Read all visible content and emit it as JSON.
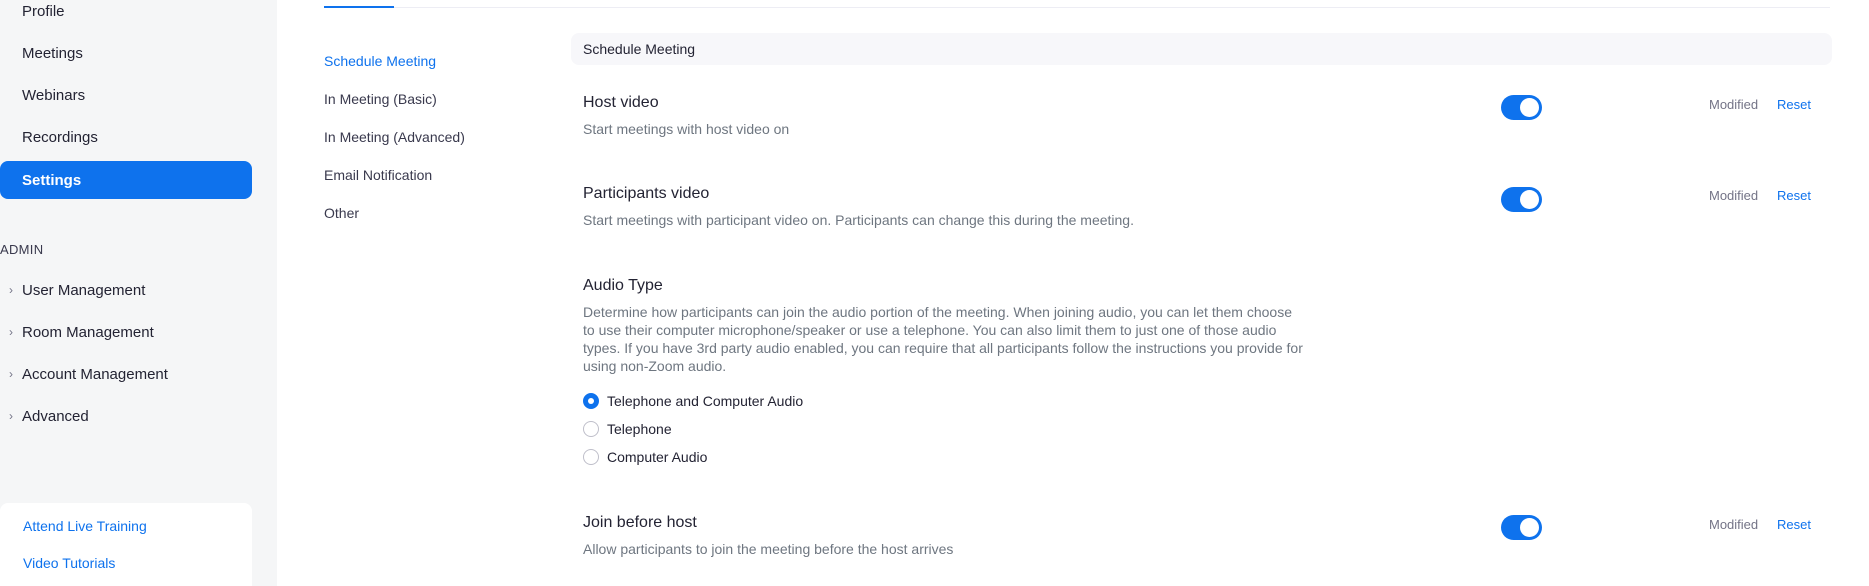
{
  "sidebar": {
    "nav": [
      {
        "label": "Profile"
      },
      {
        "label": "Meetings"
      },
      {
        "label": "Webinars"
      },
      {
        "label": "Recordings"
      },
      {
        "label": "Settings",
        "active": true
      }
    ],
    "admin_label": "ADMIN",
    "admin_items": [
      {
        "label": "User Management"
      },
      {
        "label": "Room Management"
      },
      {
        "label": "Account Management"
      },
      {
        "label": "Advanced"
      }
    ],
    "links": [
      {
        "label": "Attend Live Training"
      },
      {
        "label": "Video Tutorials"
      }
    ]
  },
  "subnav": [
    {
      "label": "Schedule Meeting",
      "active": true
    },
    {
      "label": "In Meeting (Basic)"
    },
    {
      "label": "In Meeting (Advanced)"
    },
    {
      "label": "Email Notification"
    },
    {
      "label": "Other"
    }
  ],
  "section": {
    "title": "Schedule Meeting"
  },
  "settings": {
    "host_video": {
      "title": "Host video",
      "description": "Start meetings with host video on",
      "enabled": true,
      "modified_label": "Modified",
      "reset_label": "Reset"
    },
    "participants_video": {
      "title": "Participants video",
      "description": "Start meetings with participant video on. Participants can change this during the meeting.",
      "enabled": true,
      "modified_label": "Modified",
      "reset_label": "Reset"
    },
    "audio_type": {
      "title": "Audio Type",
      "description": "Determine how participants can join the audio portion of the meeting. When joining audio, you can let them choose to use their computer microphone/speaker or use a telephone. You can also limit them to just one of those audio types. If you have 3rd party audio enabled, you can require that all participants follow the instructions you provide for using non-Zoom audio.",
      "options": [
        {
          "label": "Telephone and Computer Audio",
          "selected": true
        },
        {
          "label": "Telephone",
          "selected": false
        },
        {
          "label": "Computer Audio",
          "selected": false
        }
      ]
    },
    "join_before_host": {
      "title": "Join before host",
      "description": "Allow participants to join the meeting before the host arrives",
      "enabled": true,
      "modified_label": "Modified",
      "reset_label": "Reset"
    }
  },
  "colors": {
    "accent": "#0e72ed",
    "sidebar_bg": "#f5f6f7",
    "muted_text": "#6e7680"
  }
}
